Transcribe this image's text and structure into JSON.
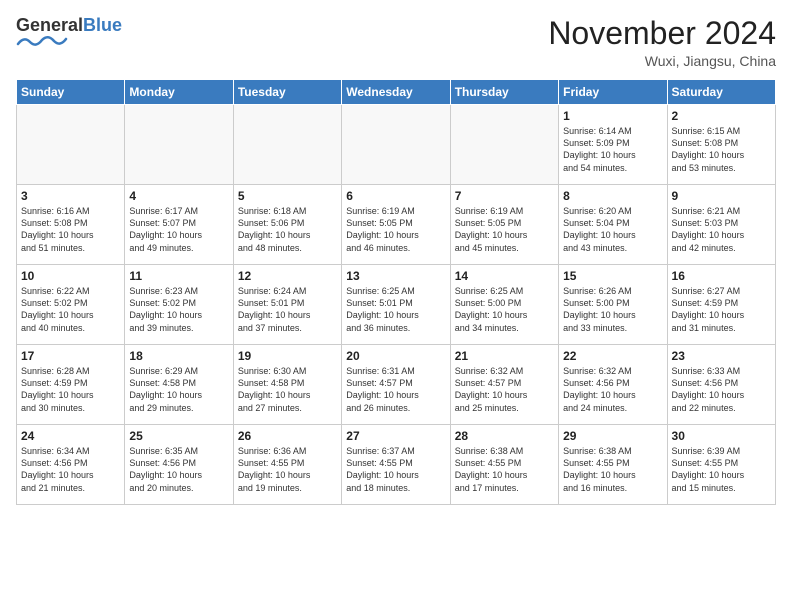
{
  "header": {
    "logo_general": "General",
    "logo_blue": "Blue",
    "month_title": "November 2024",
    "location": "Wuxi, Jiangsu, China"
  },
  "weekdays": [
    "Sunday",
    "Monday",
    "Tuesday",
    "Wednesday",
    "Thursday",
    "Friday",
    "Saturday"
  ],
  "weeks": [
    [
      {
        "day": "",
        "info": ""
      },
      {
        "day": "",
        "info": ""
      },
      {
        "day": "",
        "info": ""
      },
      {
        "day": "",
        "info": ""
      },
      {
        "day": "",
        "info": ""
      },
      {
        "day": "1",
        "info": "Sunrise: 6:14 AM\nSunset: 5:09 PM\nDaylight: 10 hours\nand 54 minutes."
      },
      {
        "day": "2",
        "info": "Sunrise: 6:15 AM\nSunset: 5:08 PM\nDaylight: 10 hours\nand 53 minutes."
      }
    ],
    [
      {
        "day": "3",
        "info": "Sunrise: 6:16 AM\nSunset: 5:08 PM\nDaylight: 10 hours\nand 51 minutes."
      },
      {
        "day": "4",
        "info": "Sunrise: 6:17 AM\nSunset: 5:07 PM\nDaylight: 10 hours\nand 49 minutes."
      },
      {
        "day": "5",
        "info": "Sunrise: 6:18 AM\nSunset: 5:06 PM\nDaylight: 10 hours\nand 48 minutes."
      },
      {
        "day": "6",
        "info": "Sunrise: 6:19 AM\nSunset: 5:05 PM\nDaylight: 10 hours\nand 46 minutes."
      },
      {
        "day": "7",
        "info": "Sunrise: 6:19 AM\nSunset: 5:05 PM\nDaylight: 10 hours\nand 45 minutes."
      },
      {
        "day": "8",
        "info": "Sunrise: 6:20 AM\nSunset: 5:04 PM\nDaylight: 10 hours\nand 43 minutes."
      },
      {
        "day": "9",
        "info": "Sunrise: 6:21 AM\nSunset: 5:03 PM\nDaylight: 10 hours\nand 42 minutes."
      }
    ],
    [
      {
        "day": "10",
        "info": "Sunrise: 6:22 AM\nSunset: 5:02 PM\nDaylight: 10 hours\nand 40 minutes."
      },
      {
        "day": "11",
        "info": "Sunrise: 6:23 AM\nSunset: 5:02 PM\nDaylight: 10 hours\nand 39 minutes."
      },
      {
        "day": "12",
        "info": "Sunrise: 6:24 AM\nSunset: 5:01 PM\nDaylight: 10 hours\nand 37 minutes."
      },
      {
        "day": "13",
        "info": "Sunrise: 6:25 AM\nSunset: 5:01 PM\nDaylight: 10 hours\nand 36 minutes."
      },
      {
        "day": "14",
        "info": "Sunrise: 6:25 AM\nSunset: 5:00 PM\nDaylight: 10 hours\nand 34 minutes."
      },
      {
        "day": "15",
        "info": "Sunrise: 6:26 AM\nSunset: 5:00 PM\nDaylight: 10 hours\nand 33 minutes."
      },
      {
        "day": "16",
        "info": "Sunrise: 6:27 AM\nSunset: 4:59 PM\nDaylight: 10 hours\nand 31 minutes."
      }
    ],
    [
      {
        "day": "17",
        "info": "Sunrise: 6:28 AM\nSunset: 4:59 PM\nDaylight: 10 hours\nand 30 minutes."
      },
      {
        "day": "18",
        "info": "Sunrise: 6:29 AM\nSunset: 4:58 PM\nDaylight: 10 hours\nand 29 minutes."
      },
      {
        "day": "19",
        "info": "Sunrise: 6:30 AM\nSunset: 4:58 PM\nDaylight: 10 hours\nand 27 minutes."
      },
      {
        "day": "20",
        "info": "Sunrise: 6:31 AM\nSunset: 4:57 PM\nDaylight: 10 hours\nand 26 minutes."
      },
      {
        "day": "21",
        "info": "Sunrise: 6:32 AM\nSunset: 4:57 PM\nDaylight: 10 hours\nand 25 minutes."
      },
      {
        "day": "22",
        "info": "Sunrise: 6:32 AM\nSunset: 4:56 PM\nDaylight: 10 hours\nand 24 minutes."
      },
      {
        "day": "23",
        "info": "Sunrise: 6:33 AM\nSunset: 4:56 PM\nDaylight: 10 hours\nand 22 minutes."
      }
    ],
    [
      {
        "day": "24",
        "info": "Sunrise: 6:34 AM\nSunset: 4:56 PM\nDaylight: 10 hours\nand 21 minutes."
      },
      {
        "day": "25",
        "info": "Sunrise: 6:35 AM\nSunset: 4:56 PM\nDaylight: 10 hours\nand 20 minutes."
      },
      {
        "day": "26",
        "info": "Sunrise: 6:36 AM\nSunset: 4:55 PM\nDaylight: 10 hours\nand 19 minutes."
      },
      {
        "day": "27",
        "info": "Sunrise: 6:37 AM\nSunset: 4:55 PM\nDaylight: 10 hours\nand 18 minutes."
      },
      {
        "day": "28",
        "info": "Sunrise: 6:38 AM\nSunset: 4:55 PM\nDaylight: 10 hours\nand 17 minutes."
      },
      {
        "day": "29",
        "info": "Sunrise: 6:38 AM\nSunset: 4:55 PM\nDaylight: 10 hours\nand 16 minutes."
      },
      {
        "day": "30",
        "info": "Sunrise: 6:39 AM\nSunset: 4:55 PM\nDaylight: 10 hours\nand 15 minutes."
      }
    ]
  ]
}
